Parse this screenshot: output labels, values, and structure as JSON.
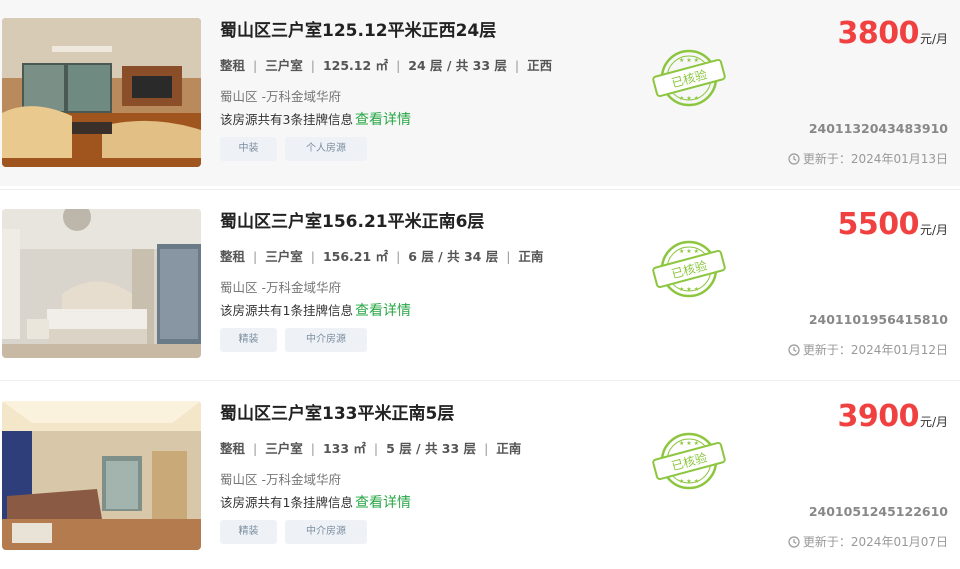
{
  "listings": [
    {
      "title": "蜀山区三户室125.12平米正西24层",
      "rent_type": "整租",
      "layout": "三户室",
      "area": "125.12 ㎡",
      "floor": "24 层 / 共 33 层",
      "orientation": "正西",
      "community": "蜀山区 -万科金域华府",
      "listing_info": "该房源共有3条挂牌信息",
      "detail_link": "查看详情",
      "tags": [
        "中装",
        "个人房源"
      ],
      "stamp": "已核验",
      "price": "3800",
      "price_unit": "元/月",
      "listing_id": "2401132043483910",
      "updated": "更新于：2024年01月13日"
    },
    {
      "title": "蜀山区三户室156.21平米正南6层",
      "rent_type": "整租",
      "layout": "三户室",
      "area": "156.21 ㎡",
      "floor": "6 层 / 共 34 层",
      "orientation": "正南",
      "community": "蜀山区 -万科金域华府",
      "listing_info": "该房源共有1条挂牌信息",
      "detail_link": "查看详情",
      "tags": [
        "精装",
        "中介房源"
      ],
      "stamp": "已核验",
      "price": "5500",
      "price_unit": "元/月",
      "listing_id": "2401101956415810",
      "updated": "更新于：2024年01月12日"
    },
    {
      "title": "蜀山区三户室133平米正南5层",
      "rent_type": "整租",
      "layout": "三户室",
      "area": "133 ㎡",
      "floor": "5 层 / 共 33 层",
      "orientation": "正南",
      "community": "蜀山区 -万科金域华府",
      "listing_info": "该房源共有1条挂牌信息",
      "detail_link": "查看详情",
      "tags": [
        "精装",
        "中介房源"
      ],
      "stamp": "已核验",
      "price": "3900",
      "price_unit": "元/月",
      "listing_id": "2401051245122610",
      "updated": "更新于：2024年01月07日"
    }
  ],
  "separator": "|",
  "colors": {
    "price": "#f04040",
    "link": "#28a745",
    "stamp": "#8cc63f"
  }
}
